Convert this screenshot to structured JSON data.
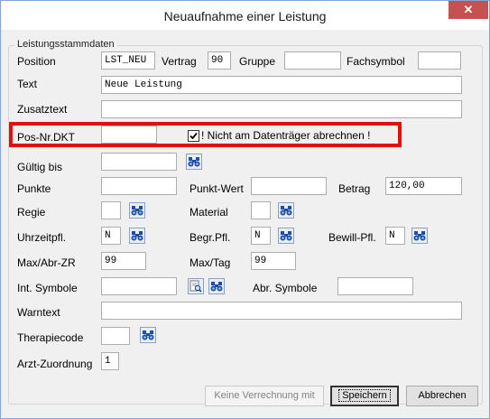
{
  "window": {
    "title": "Neuaufnahme einer Leistung",
    "close_symbol": "✕"
  },
  "group": {
    "title": "Leistungsstammdaten"
  },
  "fields": {
    "position_label": "Position",
    "position_value": "LST_NEU",
    "vertrag_label": "Vertrag",
    "vertrag_value": "90",
    "gruppe_label": "Gruppe",
    "gruppe_value": "",
    "fachsymbol_label": "Fachsymbol",
    "fachsymbol_value": "",
    "text_label": "Text",
    "text_value": "Neue Leistung",
    "zusatztext_label": "Zusatztext",
    "zusatztext_value": "",
    "posnr_label": "Pos-Nr.DKT",
    "posnr_value": "",
    "nicht_label": "! Nicht am Datenträger abrechnen !",
    "nicht_checked": true,
    "gueltig_label": "Gültig bis",
    "gueltig_value": "",
    "punkte_label": "Punkte",
    "punkte_value": "",
    "punktwert_label": "Punkt-Wert",
    "punktwert_value": "",
    "betrag_label": "Betrag",
    "betrag_value": "120,00",
    "regie_label": "Regie",
    "regie_value": "",
    "material_label": "Material",
    "material_value": "",
    "uhrzeit_label": "Uhrzeitpfl.",
    "uhrzeit_value": "N",
    "begr_label": "Begr.Pfl.",
    "begr_value": "N",
    "bewill_label": "Bewill-Pfl.",
    "bewill_value": "N",
    "maxabr_label": "Max/Abr-ZR",
    "maxabr_value": "99",
    "maxtag_label": "Max/Tag",
    "maxtag_value": "99",
    "intsym_label": "Int. Symbole",
    "intsym_value": "",
    "abrsym_label": "Abr. Symbole",
    "abrsym_value": "",
    "warntext_label": "Warntext",
    "warntext_value": "",
    "therapie_label": "Therapiecode",
    "therapie_value": "",
    "arzt_label": "Arzt-Zuordnung",
    "arzt_value": "1"
  },
  "buttons": {
    "keine_label": "Keine Verrechnung mit",
    "speichern_label": "Speichern",
    "abbrechen_label": "Abbrechen"
  },
  "colors": {
    "highlight": "#e01010",
    "close": "#c75050",
    "lookup_icon": "#1a4fa3"
  },
  "icons": {
    "lookup": "binoculars-icon",
    "search_list": "search-list-icon"
  }
}
